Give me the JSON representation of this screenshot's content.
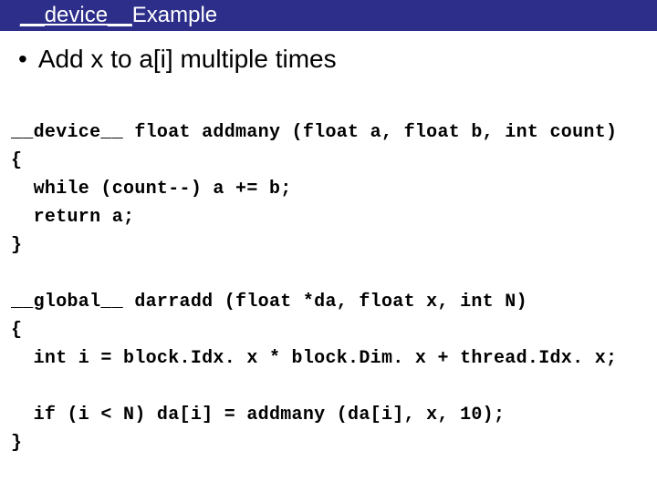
{
  "title": {
    "part1": "__device__",
    "part2": " Example"
  },
  "bullet": "Add x to a[i] multiple times",
  "code": "__device__ float addmany (float a, float b, int count)\n{\n  while (count--) a += b;\n  return a;\n}\n\n__global__ darradd (float *da, float x, int N)\n{\n  int i = block.Idx. x * block.Dim. x + thread.Idx. x;\n\n  if (i < N) da[i] = addmany (da[i], x, 10);\n}"
}
